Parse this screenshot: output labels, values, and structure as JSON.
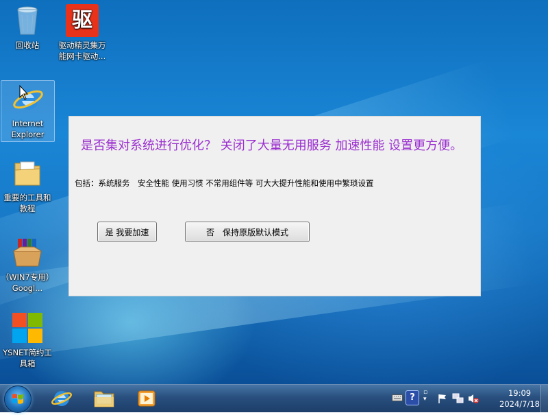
{
  "desktop_icons": [
    {
      "name": "recycle-bin",
      "label": "回收站"
    },
    {
      "name": "drivers-genius",
      "label": "驱动精灵集万能网卡驱动...",
      "glyph": "驱"
    },
    {
      "name": "internet-explorer",
      "label": "Internet Explorer"
    },
    {
      "name": "important-tools",
      "label": "重要的工具和教程"
    },
    {
      "name": "google-chrome-win7",
      "label": "（WIN7专用）Googl..."
    },
    {
      "name": "ysnet-toolbox",
      "label": "YSNET简约工具箱"
    }
  ],
  "dialog": {
    "title": "是否集对系统进行优化？ 关闭了大量无用服务 加速性能 设置更方便。",
    "info": "包括：系统服务　安全性能  使用习惯  不常用组件等  可大大提升性能和使用中繁琐设置",
    "yes_label": "是 我要加速",
    "no_label": "否　保持原版默认模式"
  },
  "taskbar": {
    "apps": [
      "internet-explorer",
      "file-explorer",
      "media-player"
    ]
  },
  "clock": {
    "time": "19:09",
    "date": "2024/7/18"
  },
  "colors": {
    "dialog_title": "#9b2fcf",
    "dialog_bg": "#f0f0f0",
    "taskbar": "#1e466f"
  }
}
